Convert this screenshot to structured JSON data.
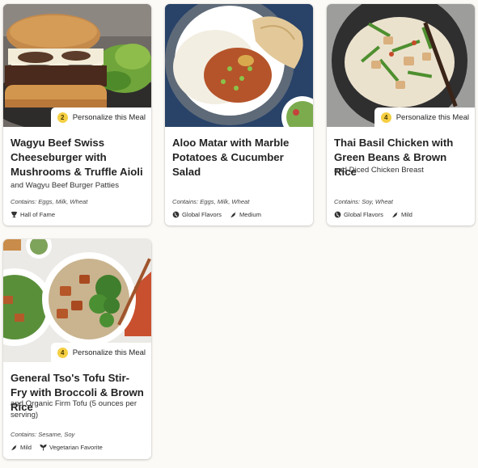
{
  "personalize_label": "Personalize this Meal",
  "meals": [
    {
      "title": "Wagyu Beef Swiss Cheeseburger with Mushrooms & Truffle Aioli",
      "subtitle": "and Wagyu Beef Burger Patties",
      "contains": "Contains: Eggs, Milk, Wheat",
      "personalize_count": "2",
      "tags": [
        {
          "icon": "trophy-icon",
          "label": "Hall of Fame"
        }
      ]
    },
    {
      "title": "Aloo Matar with Marble Potatoes & Cucumber Salad",
      "subtitle": "",
      "contains": "Contains: Eggs, Milk, Wheat",
      "personalize_count": "",
      "tags": [
        {
          "icon": "globe-icon",
          "label": "Global Flavors"
        },
        {
          "icon": "chili-pepper-icon",
          "label": "Medium"
        }
      ]
    },
    {
      "title": "Thai Basil Chicken with Green Beans & Brown Rice",
      "subtitle": "and Diced Chicken Breast",
      "contains": "Contains: Soy, Wheat",
      "personalize_count": "4",
      "tags": [
        {
          "icon": "globe-icon",
          "label": "Global Flavors"
        },
        {
          "icon": "chili-pepper-icon",
          "label": "Mild"
        }
      ]
    },
    {
      "title": "General Tso's Tofu Stir-Fry with Broccoli & Brown Rice",
      "subtitle": "and Organic Firm Tofu (5 ounces per serving)",
      "contains": "Contains: Sesame, Soy",
      "personalize_count": "4",
      "tags": [
        {
          "icon": "chili-pepper-icon",
          "label": "Mild"
        },
        {
          "icon": "leaf-icon",
          "label": "Vegetarian Favorite"
        }
      ]
    }
  ]
}
